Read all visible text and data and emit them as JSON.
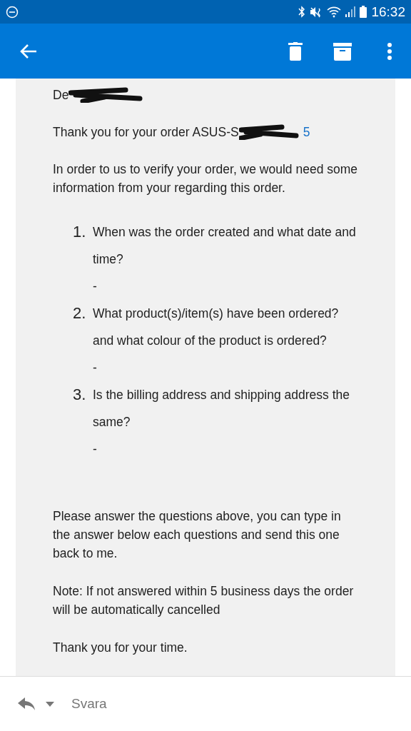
{
  "status_bar": {
    "time": "16:32"
  },
  "email": {
    "greeting": "De",
    "order_line": "Thank you for your order ASUS-S",
    "order_link": "5",
    "intro": "In order to us to verify your order, we would need some information from your regarding this order.",
    "questions": [
      {
        "number": "1.",
        "text": "When was the order created and what date and time?",
        "answer": "-"
      },
      {
        "number": "2.",
        "text": "What product(s)/item(s) have been ordered? and what colour of the product is ordered?",
        "answer": "-"
      },
      {
        "number": "3.",
        "text": "Is the billing address and shipping address the same?",
        "answer": "-"
      }
    ],
    "paragraphs": [
      "Please answer the questions above, you can type in the answer below each questions and send this one back to me.",
      "Note: If not answered within 5 business days the order will be automatically cancelled",
      "Thank you for your time."
    ]
  },
  "reply_bar": {
    "label": "Svara"
  }
}
